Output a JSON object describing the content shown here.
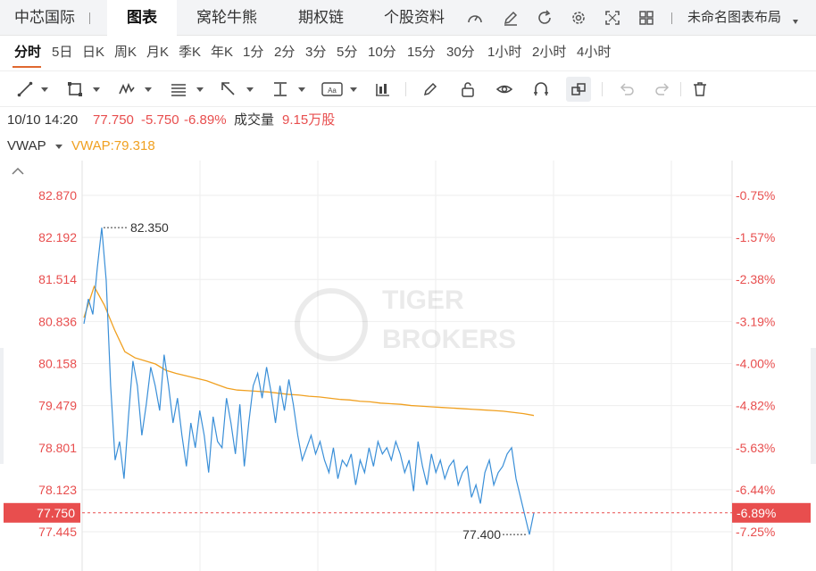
{
  "tabs": {
    "stock_name": "中芯国际",
    "chart": "图表",
    "warrants": "窝轮牛熊",
    "options": "期权链",
    "profile": "个股资料",
    "layout": "未命名图表布局"
  },
  "periods": [
    "分时",
    "5日",
    "日K",
    "周K",
    "月K",
    "季K",
    "年K",
    "1分",
    "2分",
    "3分",
    "5分",
    "10分",
    "15分",
    "30分",
    "1小时",
    "2小时",
    "4小时"
  ],
  "toolbar_icons": [
    "line-tool-icon",
    "rect-tool-icon",
    "wave-tool-icon",
    "fib-tool-icon",
    "arrow-tool-icon",
    "measure-tool-icon",
    "text-tool-icon",
    "candle-tool-icon",
    "pen-icon",
    "unlock-icon",
    "eye-icon",
    "magnet-icon",
    "clone-icon",
    "undo-icon",
    "redo-icon",
    "trash-icon"
  ],
  "info": {
    "datetime": "10/10 14:20",
    "price": "77.750",
    "change": "-5.750",
    "change_pct": "-6.89%",
    "volume_label": "成交量",
    "volume": "9.15万股"
  },
  "indicator": {
    "name": "VWAP",
    "value_text": "VWAP:79.318"
  },
  "watermark": {
    "line1": "TIGER",
    "line2": "BROKERS"
  },
  "colors": {
    "price_line": "#3a8fd8",
    "vwap_line": "#f0a020",
    "up_red": "#e84e4e",
    "grid": "#eeeeee"
  },
  "chart_data": {
    "type": "line",
    "y_ticks": [
      82.87,
      82.192,
      81.514,
      80.836,
      80.158,
      79.479,
      78.801,
      78.123,
      77.445
    ],
    "y_ticks_pct": [
      "-0.75%",
      "-1.57%",
      "-2.38%",
      "-3.19%",
      "-4.00%",
      "-4.82%",
      "-5.63%",
      "-6.44%",
      "-7.25%"
    ],
    "ylim": [
      77.2,
      83.1
    ],
    "last_price": "77.750",
    "last_pct": "-6.89%",
    "high_label": "82.350",
    "low_label": "77.400",
    "high": 82.35,
    "low": 77.4,
    "series": [
      {
        "values": [
          80.8,
          81.2,
          80.95,
          81.7,
          82.35,
          81.5,
          79.8,
          78.6,
          78.9,
          78.3,
          79.3,
          80.2,
          79.8,
          79.0,
          79.5,
          80.1,
          79.8,
          79.4,
          80.3,
          79.8,
          79.2,
          79.6,
          79.0,
          78.5,
          79.2,
          78.8,
          79.4,
          79.0,
          78.4,
          79.3,
          78.9,
          78.8,
          79.6,
          79.2,
          78.7,
          79.5,
          78.5,
          79.2,
          79.8,
          80.0,
          79.6,
          80.1,
          79.7,
          79.2,
          79.8,
          79.4,
          79.9,
          79.5,
          79.0,
          78.6,
          78.8,
          79.0,
          78.7,
          78.9,
          78.6,
          78.4,
          78.8,
          78.3,
          78.6,
          78.5,
          78.7,
          78.2,
          78.6,
          78.4,
          78.8,
          78.5,
          78.9,
          78.7,
          78.8,
          78.6,
          78.9,
          78.7,
          78.4,
          78.6,
          78.1,
          78.9,
          78.5,
          78.2,
          78.7,
          78.4,
          78.6,
          78.3,
          78.5,
          78.6,
          78.2,
          78.4,
          78.5,
          78.0,
          78.2,
          77.9,
          78.4,
          78.6,
          78.2,
          78.4,
          78.5,
          78.7,
          78.8,
          78.3,
          78.0,
          77.7,
          77.4,
          77.75
        ],
        "color": "#3a8fd8"
      },
      {
        "name": "VWAP",
        "values": [
          80.9,
          81.4,
          81.1,
          80.7,
          80.35,
          80.25,
          80.2,
          80.15,
          80.05,
          80.0,
          79.96,
          79.92,
          79.88,
          79.82,
          79.76,
          79.73,
          79.72,
          79.71,
          79.7,
          79.68,
          79.66,
          79.65,
          79.63,
          79.62,
          79.6,
          79.58,
          79.57,
          79.55,
          79.54,
          79.52,
          79.51,
          79.5,
          79.48,
          79.47,
          79.46,
          79.45,
          79.44,
          79.43,
          79.42,
          79.41,
          79.4,
          79.39,
          79.37,
          79.35,
          79.32
        ],
        "color": "#f0a020"
      }
    ]
  }
}
